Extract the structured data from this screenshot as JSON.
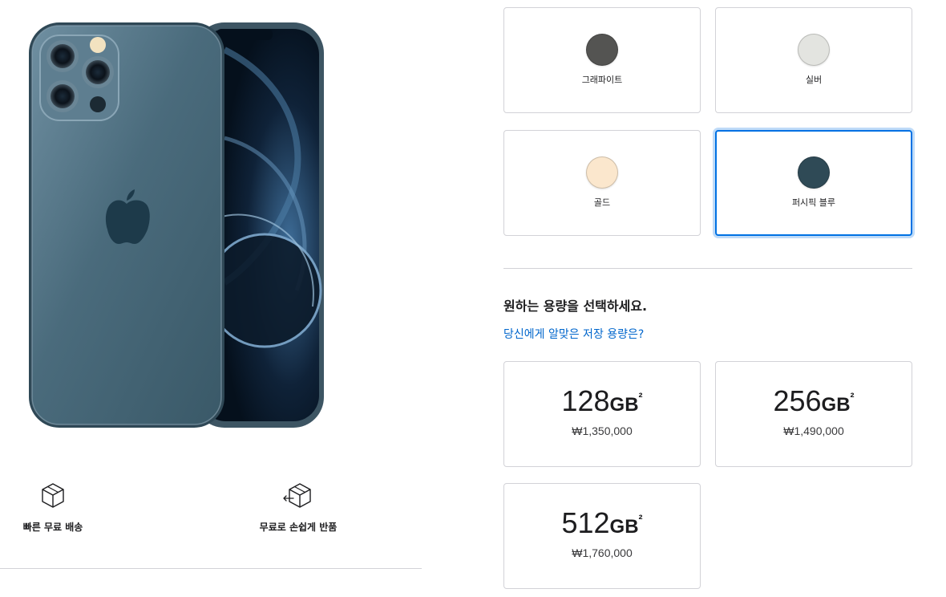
{
  "colors": {
    "heading_color": "#1d1d1f",
    "link_color": "#0066cc",
    "selected_border": "#0071e3",
    "tile_border": "#d2d2d7"
  },
  "product_image": {
    "icon": "iphone-12-pro-pacific-blue-image"
  },
  "perks": [
    {
      "label": "빠른 무료 배송",
      "icon": "box-icon"
    },
    {
      "label": "무료로 손쉽게 반품",
      "icon": "box-return-icon"
    }
  ],
  "color_options": [
    {
      "name": "그래파이트",
      "swatch": "#545452",
      "selected": false
    },
    {
      "name": "실버",
      "swatch": "#e3e4e0",
      "selected": false
    },
    {
      "name": "골드",
      "swatch": "#fbe7cd",
      "selected": false
    },
    {
      "name": "퍼시픽 블루",
      "swatch": "#2f4a56",
      "selected": true
    }
  ],
  "storage": {
    "heading": "원하는 용량을 선택하세요.",
    "help_link": "당신에게 알맞은 저장 용량은?",
    "options": [
      {
        "capacity": "128",
        "unit": "GB",
        "footnote": "²",
        "price": "₩1,350,000"
      },
      {
        "capacity": "256",
        "unit": "GB",
        "footnote": "²",
        "price": "₩1,490,000"
      },
      {
        "capacity": "512",
        "unit": "GB",
        "footnote": "²",
        "price": "₩1,760,000"
      }
    ]
  }
}
